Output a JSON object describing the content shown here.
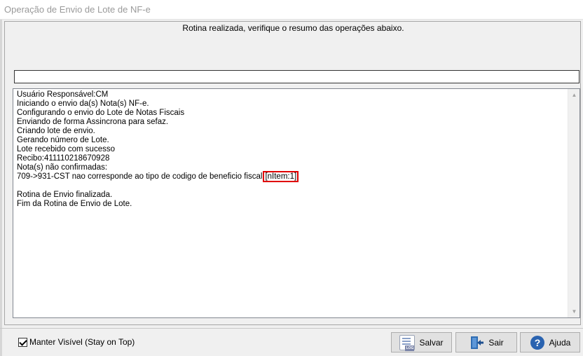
{
  "window": {
    "title": "Operação de Envio de Lote de NF-e"
  },
  "status_message": "Rotina realizada, verifique o resumo das operações abaixo.",
  "log": {
    "lines": [
      "Usuário Responsável:CM",
      "Iniciando o envio da(s) Nota(s) NF-e.",
      "Configurando o envio do Lote de Notas Fiscais",
      "Enviando de forma Assincrona para sefaz.",
      "Criando lote de envio.",
      "Gerando número de Lote.",
      "Lote recebido com sucesso",
      "Recibo:411110218670928",
      "Nota(s) não confirmadas:",
      "709->931-CST nao corresponde ao tipo de codigo de beneficio fiscal",
      "",
      "Rotina de Envio finalizada.",
      "Fim da Rotina de Envio de Lote."
    ],
    "highlight": "[nItem:1]",
    "highlight_color": "#e00000"
  },
  "footer": {
    "stay_on_top_label": "Manter Visível (Stay on Top)",
    "stay_on_top_checked": true,
    "buttons": {
      "salvar": "Salvar",
      "sair": "Sair",
      "ajuda": "Ajuda"
    }
  },
  "icons": {
    "salvar": "log-file-icon",
    "sair": "exit-door-icon",
    "ajuda": "help-question-icon",
    "log_tag": "LOG"
  }
}
